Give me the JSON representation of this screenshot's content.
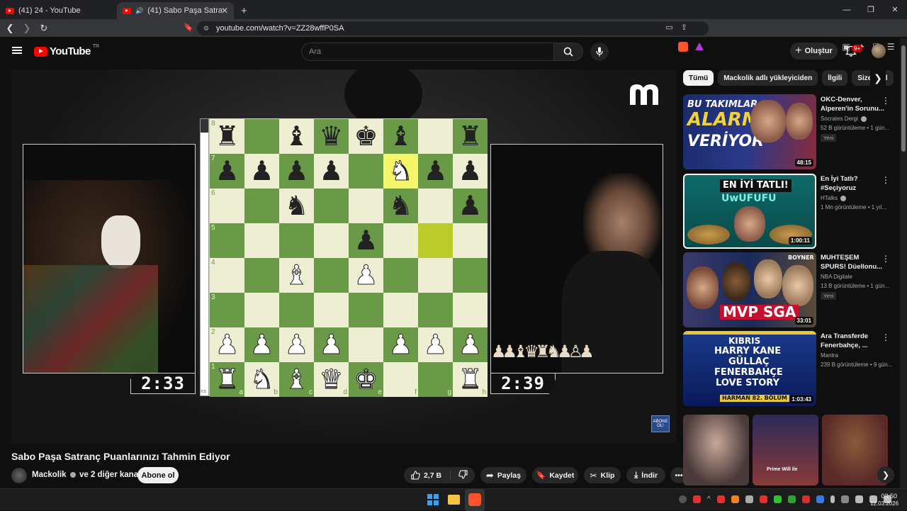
{
  "browser": {
    "tabs": [
      {
        "label": "(41) 24 - YouTube"
      },
      {
        "label": "(41) Sabo Paşa Satranç Puanlarınızı Tahmin Ediyor"
      }
    ],
    "url": "youtube.com/watch?v=ZZ28wffP0SA"
  },
  "header": {
    "logo_text": "YouTube",
    "logo_country": "TR",
    "search_placeholder": "Ara",
    "create_label": "Oluştur",
    "notifications_badge": "9+"
  },
  "player": {
    "clock_left": "2:33",
    "clock_right": "2:39",
    "abone_badge": "ABONE OL!",
    "eval_value": "0.5",
    "board": {
      "ranks": [
        "8",
        "7",
        "6",
        "5",
        "4",
        "3",
        "2",
        "1"
      ],
      "files": [
        "a",
        "b",
        "c",
        "d",
        "e",
        "f",
        "g",
        "h"
      ],
      "position": [
        [
          "br",
          "",
          "bb",
          "bq",
          "bk",
          "bb",
          "",
          "br"
        ],
        [
          "bp",
          "bp",
          "bp",
          "bp",
          "",
          "wn",
          "bp",
          "bp"
        ],
        [
          "",
          "",
          "bn",
          "",
          "",
          "bn",
          "",
          "bp"
        ],
        [
          "",
          "",
          "",
          "",
          "bp",
          "",
          "",
          ""
        ],
        [
          "",
          "",
          "wb",
          "",
          "wp",
          "",
          "",
          ""
        ],
        [
          "",
          "",
          "",
          "",
          "",
          "",
          "",
          ""
        ],
        [
          "wp",
          "wp",
          "wp",
          "wp",
          "",
          "wp",
          "wp",
          "wp"
        ],
        [
          "wr",
          "wn",
          "wb",
          "wq",
          "wk",
          "",
          "",
          "wr"
        ]
      ],
      "highlights": [
        "f7",
        "g5"
      ]
    }
  },
  "video": {
    "title": "Sabo Paşa Satranç Puanlarınızı Tahmin Ediyor",
    "channel": "Mackolik",
    "channel_suffix": "ve 2 diğer kanal",
    "subscribe_label": "Abone ol",
    "likes": "2,7 B",
    "share_label": "Paylaş",
    "save_label": "Kaydet",
    "clip_label": "Klip",
    "download_label": "İndir"
  },
  "sidebar": {
    "chips": [
      "Tümü",
      "Mackolik adlı yükleyiciden",
      "İlgili",
      "Size özel"
    ],
    "recommendations": [
      {
        "title": "OKC-Denver, Alperen'in Sorunu...",
        "channel": "Socrates Dergi",
        "meta": "52 B görüntüleme • 1 gün...",
        "badge": "Yeni",
        "duration": "48:15",
        "thumb_lines": [
          "BU TAKIMLAR",
          "ALARM",
          "VERİYOR"
        ]
      },
      {
        "title": "En İyi Tatlı? #Seçiyoruz",
        "channel": "HTalks",
        "meta": "1 Mn görüntüleme • 1 yıl...",
        "badge": "",
        "duration": "1:00:11",
        "thumb_lines": [
          "EN İYİ TATLI!",
          "UwUFUFU"
        ]
      },
      {
        "title": "MUHTEŞEM SPURS! Düellonu...",
        "channel": "NBA Digitale",
        "meta": "13 B görüntüleme • 1 gün...",
        "badge": "Yeni",
        "duration": "33:01",
        "thumb_lines": [
          "BOYNER",
          "MVP SGA"
        ]
      },
      {
        "title": "Ara Transferde Fenerbahçe, ...",
        "channel": "Mantra",
        "meta": "239 B görüntüleme • 9 gün...",
        "badge": "",
        "duration": "1:03:43",
        "thumb_lines": [
          "KIBRIS",
          "HARRY KANE",
          "GÜLLAÇ",
          "FENERBAHÇE",
          "LOVE STORY",
          "HARMAN 82. BÖLÜM"
        ]
      }
    ],
    "shorts_caption": "Prime Will ile"
  },
  "taskbar": {
    "time": "03:50",
    "date": "12.03.2026"
  }
}
